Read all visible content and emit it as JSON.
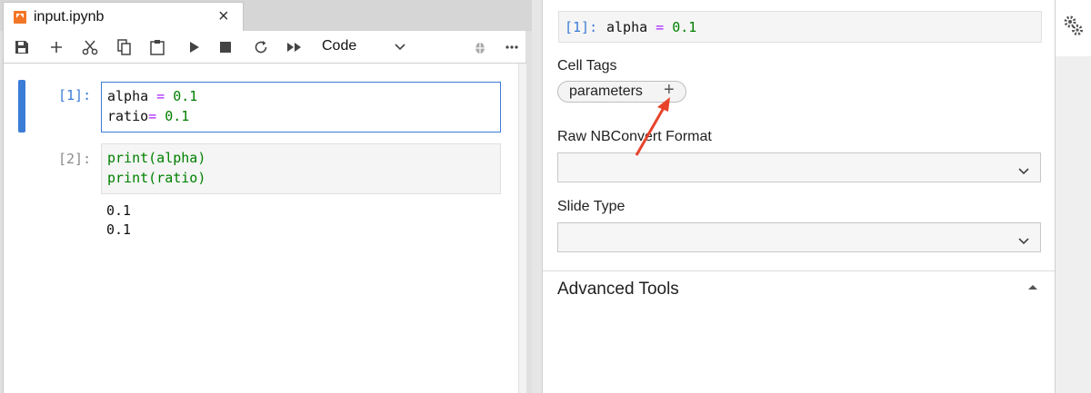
{
  "tab": {
    "title": "input.ipynb",
    "close_glyph": "×"
  },
  "toolbar": {
    "cell_type": "Code",
    "icons": [
      "save-icon",
      "add-cell-icon",
      "cut-icon",
      "copy-icon",
      "paste-icon",
      "run-icon",
      "stop-icon",
      "restart-icon",
      "run-all-icon",
      "cell-type-dropdown",
      "debugger-icon",
      "more-icon"
    ]
  },
  "cells": [
    {
      "prompt": "[1]:",
      "lines": [
        {
          "var": "alpha",
          "op": " = ",
          "num": "0.1"
        },
        {
          "var": "ratio",
          "op": "= ",
          "num": "0.1"
        }
      ]
    },
    {
      "prompt": "[2]:",
      "lines": [
        {
          "text": "print(alpha)"
        },
        {
          "text": "print(ratio)"
        }
      ],
      "outputs": [
        "0.1",
        "0.1"
      ]
    }
  ],
  "inspector": {
    "active_prompt": "[1]:",
    "active_code": {
      "var": "alpha",
      "op": " = ",
      "num": "0.1"
    },
    "cell_tags_label": "Cell Tags",
    "tags": [
      "parameters"
    ],
    "add_tag_glyph": "+",
    "raw_format_label": "Raw NBConvert Format",
    "raw_format_value": "",
    "slide_type_label": "Slide Type",
    "slide_type_value": "",
    "advanced_tools_label": "Advanced Tools"
  },
  "colors": {
    "accent": "#3b7cd6",
    "jupyter_orange": "#f37626",
    "annotation_arrow": "#e8432a"
  }
}
